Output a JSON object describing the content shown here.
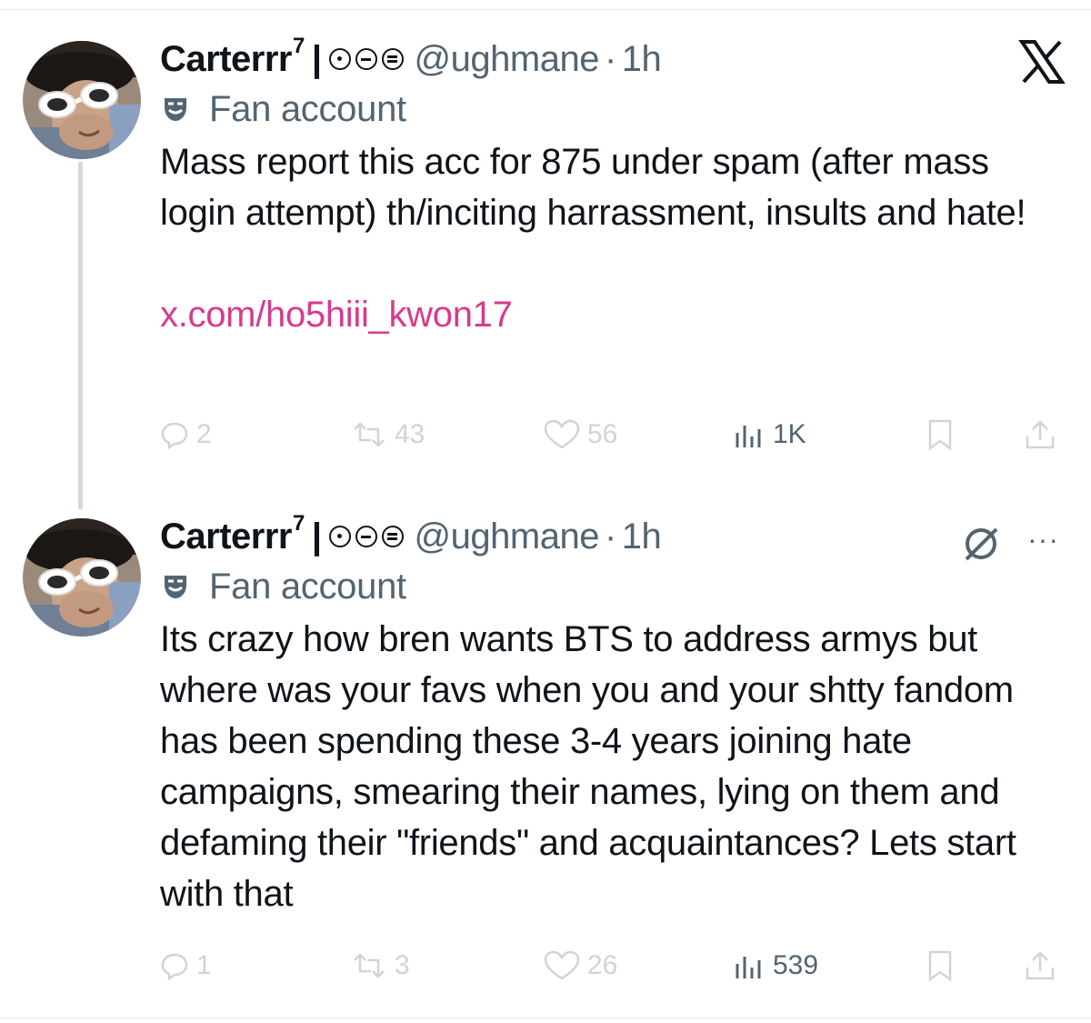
{
  "brand": {
    "accent_link": "#d83a8c",
    "text": "#0f1419",
    "muted": "#536471",
    "faint": "#cfd4d8"
  },
  "tweets": [
    {
      "author_name": "Carterrr",
      "author_superscript": "7",
      "separator": "|",
      "handle": "@ughmane",
      "dot": "·",
      "time": "1h",
      "label": "Fan account",
      "text": "Mass report this acc for 875 under spam (after mass login attempt) th/inciting harrassment, insults and hate!",
      "link": "x.com/ho5hiii_kwon17",
      "stats": {
        "replies": "2",
        "reposts": "43",
        "likes": "56",
        "views": "1K"
      },
      "corner_icon": "x-logo-icon"
    },
    {
      "author_name": "Carterrr",
      "author_superscript": "7",
      "separator": "|",
      "handle": "@ughmane",
      "dot": "·",
      "time": "1h",
      "label": "Fan account",
      "text": "Its crazy how bren wants BTS to address armys but where was your favs when you and your shtty fandom has been spending these 3-4 years joining hate campaigns, smearing their names, lying on them and defaming their \"friends\" and acquaintances? Lets start with that",
      "more_label": "···",
      "stats": {
        "replies": "1",
        "reposts": "3",
        "likes": "26",
        "views": "539"
      },
      "corner_icon": "grok-icon"
    }
  ]
}
